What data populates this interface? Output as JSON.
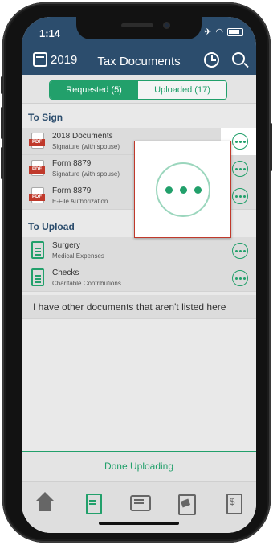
{
  "status": {
    "time": "1:14"
  },
  "header": {
    "year": "2019",
    "title": "Tax Documents"
  },
  "segments": [
    {
      "label": "Requested (5)",
      "active": true
    },
    {
      "label": "Uploaded (17)",
      "active": false
    }
  ],
  "to_sign": {
    "title": "To Sign",
    "items": [
      {
        "name": "2018 Documents",
        "detail": "Signature (with spouse)",
        "type": "PDF"
      },
      {
        "name": "Form 8879",
        "detail": "Signature (with spouse)",
        "type": "PDF"
      },
      {
        "name": "Form 8879",
        "detail": "E-File Authorization",
        "type": "PDF"
      }
    ]
  },
  "to_upload": {
    "title": "To Upload",
    "items": [
      {
        "name": "Surgery",
        "detail": "Medical Expenses"
      },
      {
        "name": "Checks",
        "detail": "Charitable Contributions"
      }
    ]
  },
  "other_docs": "I have other documents that aren't listed here",
  "done_button": "Done Uploading",
  "tabs": [
    "home-icon",
    "documents-icon",
    "messages-icon",
    "tax-return-icon",
    "invoice-icon"
  ],
  "colors": {
    "header": "#2c4d6d",
    "accent": "#22a06b",
    "highlight_border": "#c0392b"
  }
}
